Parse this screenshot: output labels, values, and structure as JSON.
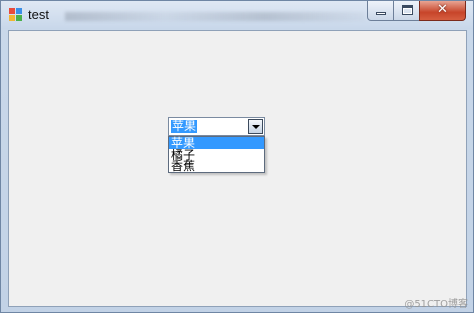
{
  "window": {
    "title": "test",
    "close_glyph": "✕"
  },
  "combo": {
    "selected": "苹果",
    "options": [
      "苹果",
      "橘子",
      "香蕉"
    ]
  },
  "watermark": "@51CTO博客"
}
